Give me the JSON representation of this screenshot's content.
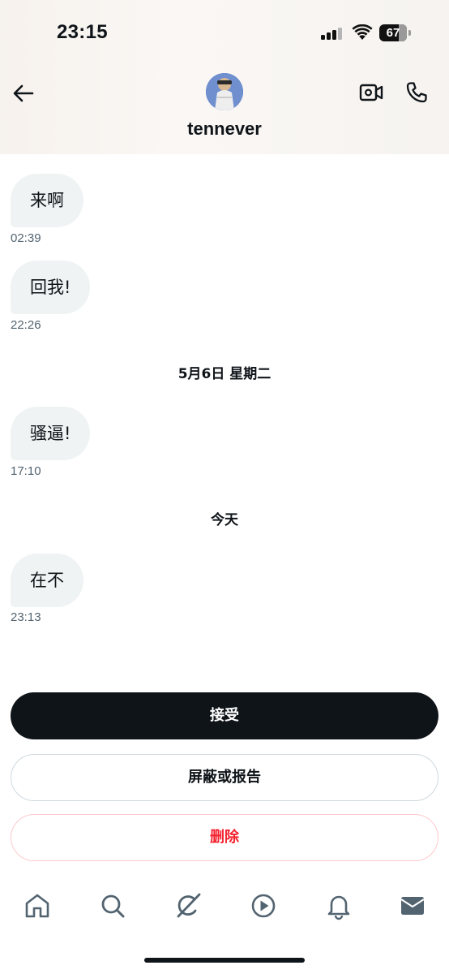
{
  "status_bar": {
    "time": "23:15",
    "battery_level": "67",
    "signal_icon": "cellular-signal-icon",
    "wifi_icon": "wifi-icon",
    "battery_icon": "battery-icon"
  },
  "header": {
    "back_icon": "arrow-left-icon",
    "username": "tennever",
    "video_icon": "video-camera-icon",
    "phone_icon": "phone-icon"
  },
  "messages": [
    {
      "text": "来啊",
      "time": "02:39"
    },
    {
      "text": "回我!",
      "time": "22:26"
    },
    {
      "type": "date",
      "label": "5月6日 星期二"
    },
    {
      "text": "骚逼!",
      "time": "17:10"
    },
    {
      "type": "date",
      "label": "今天"
    },
    {
      "text": "在不",
      "time": "23:13"
    }
  ],
  "actions": {
    "accept_label": "接受",
    "block_report_label": "屏蔽或报告",
    "delete_label": "删除"
  },
  "bottom_nav": {
    "items": [
      "home-icon",
      "search-icon",
      "grok-icon",
      "video-play-icon",
      "notifications-bell-icon",
      "messages-envelope-icon"
    ],
    "active": "messages-envelope-icon"
  },
  "colors": {
    "text": "#0f1419",
    "secondary_text": "#536471",
    "bubble": "#eff3f4",
    "danger": "#f4212e"
  }
}
